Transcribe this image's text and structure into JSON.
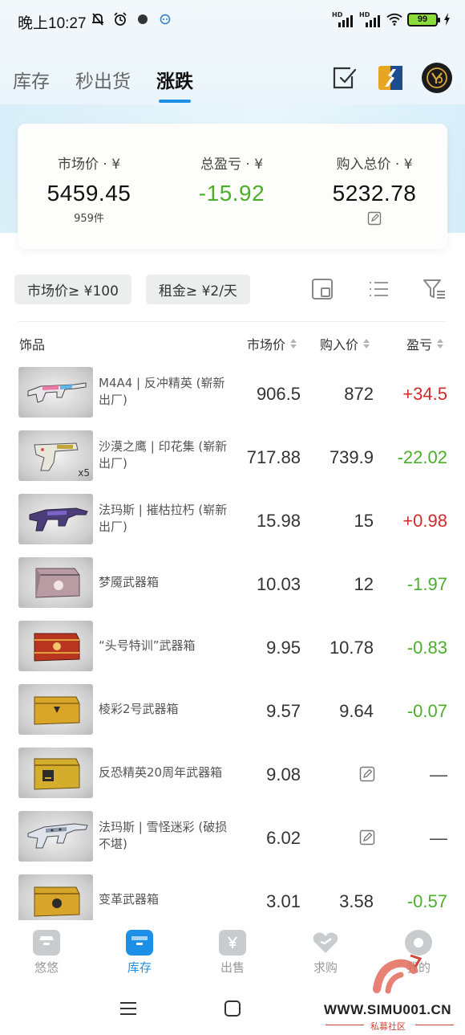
{
  "status_bar": {
    "time": "晚上10:27",
    "battery": "99",
    "hd1": "HD",
    "hd2": "HD"
  },
  "header": {
    "tabs": [
      {
        "label": "库存"
      },
      {
        "label": "秒出货"
      },
      {
        "label": "涨跌"
      }
    ],
    "active_tab": 2
  },
  "summary": {
    "market_label": "市场价 · ¥",
    "market_value": "5459.45",
    "market_count": "959件",
    "pnl_label": "总盈亏 · ¥",
    "pnl_value": "-15.92",
    "purchase_label": "购入总价 · ¥",
    "purchase_value": "5232.78"
  },
  "filters": [
    {
      "label": "市场价≥ ¥100"
    },
    {
      "label": "租金≥ ¥2/天"
    }
  ],
  "table": {
    "columns": [
      "饰品",
      "市场价",
      "购入价",
      "盈亏"
    ],
    "rows": [
      {
        "name": "M4A4 | 反冲精英 (崭新出厂)",
        "market": "906.5",
        "buy": "872",
        "pnl": "+34.5",
        "pnl_type": "up",
        "thumb": "rifle-pink"
      },
      {
        "name": "沙漠之鹰 | 印花集 (崭新出厂)",
        "market": "717.88",
        "buy": "739.9",
        "pnl": "-22.02",
        "pnl_type": "down",
        "thumb": "pistol",
        "qty": "x5"
      },
      {
        "name": "法玛斯 | 摧枯拉朽 (崭新出厂)",
        "market": "15.98",
        "buy": "15",
        "pnl": "+0.98",
        "pnl_type": "up",
        "thumb": "rifle-purple"
      },
      {
        "name": "梦魇武器箱",
        "market": "10.03",
        "buy": "12",
        "pnl": "-1.97",
        "pnl_type": "down",
        "thumb": "case-red"
      },
      {
        "name": "“头号特训”武器箱",
        "market": "9.95",
        "buy": "10.78",
        "pnl": "-0.83",
        "pnl_type": "down",
        "thumb": "case-dark"
      },
      {
        "name": "棱彩2号武器箱",
        "market": "9.57",
        "buy": "9.64",
        "pnl": "-0.07",
        "pnl_type": "down",
        "thumb": "case-gold"
      },
      {
        "name": "反恐精英20周年武器箱",
        "market": "9.08",
        "buy": "",
        "pnl": "—",
        "pnl_type": "none",
        "thumb": "case-gold20"
      },
      {
        "name": "法玛斯 | 雪怪迷彩 (破损不堪)",
        "market": "6.02",
        "buy": "",
        "pnl": "—",
        "pnl_type": "none",
        "thumb": "rifle-camo"
      },
      {
        "name": "变革武器箱",
        "market": "3.01",
        "buy": "3.58",
        "pnl": "-0.57",
        "pnl_type": "down",
        "thumb": "case-gold"
      }
    ]
  },
  "bottom_nav": [
    {
      "label": "悠悠"
    },
    {
      "label": "库存"
    },
    {
      "label": "出售"
    },
    {
      "label": "求购"
    },
    {
      "label": "我的"
    }
  ],
  "watermark": {
    "url": "WWW.SIMU001.CN",
    "sub": "私募社区"
  },
  "colors": {
    "accent": "#1e8fe6",
    "profit": "#d22b2b",
    "loss": "#4caf2a"
  }
}
